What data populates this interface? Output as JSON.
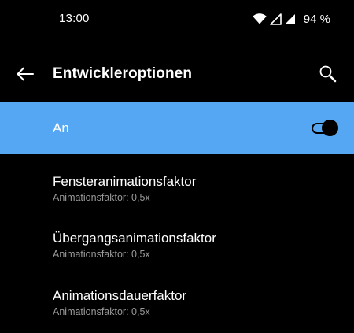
{
  "colors": {
    "background": "#000000",
    "accent": "#55a7f3",
    "text_primary": "#ffffff",
    "text_secondary": "#9a9a9a"
  },
  "status_bar": {
    "time": "13:00",
    "battery": "94 %",
    "icons": [
      "wifi-icon",
      "cell-signal-icon",
      "cell-signal-icon",
      "battery-percentage"
    ]
  },
  "toolbar": {
    "back_icon": "back-arrow-icon",
    "title": "Entwickleroptionen",
    "search_icon": "search-icon"
  },
  "master_switch": {
    "label": "An",
    "checked": true
  },
  "settings": [
    {
      "title": "Fensteranimationsfaktor",
      "summary": "Animationsfaktor: 0,5x"
    },
    {
      "title": "Übergangsanimationsfaktor",
      "summary": "Animationsfaktor: 0,5x"
    },
    {
      "title": "Animationsdauerfaktor",
      "summary": "Animationsfaktor: 0,5x"
    }
  ]
}
